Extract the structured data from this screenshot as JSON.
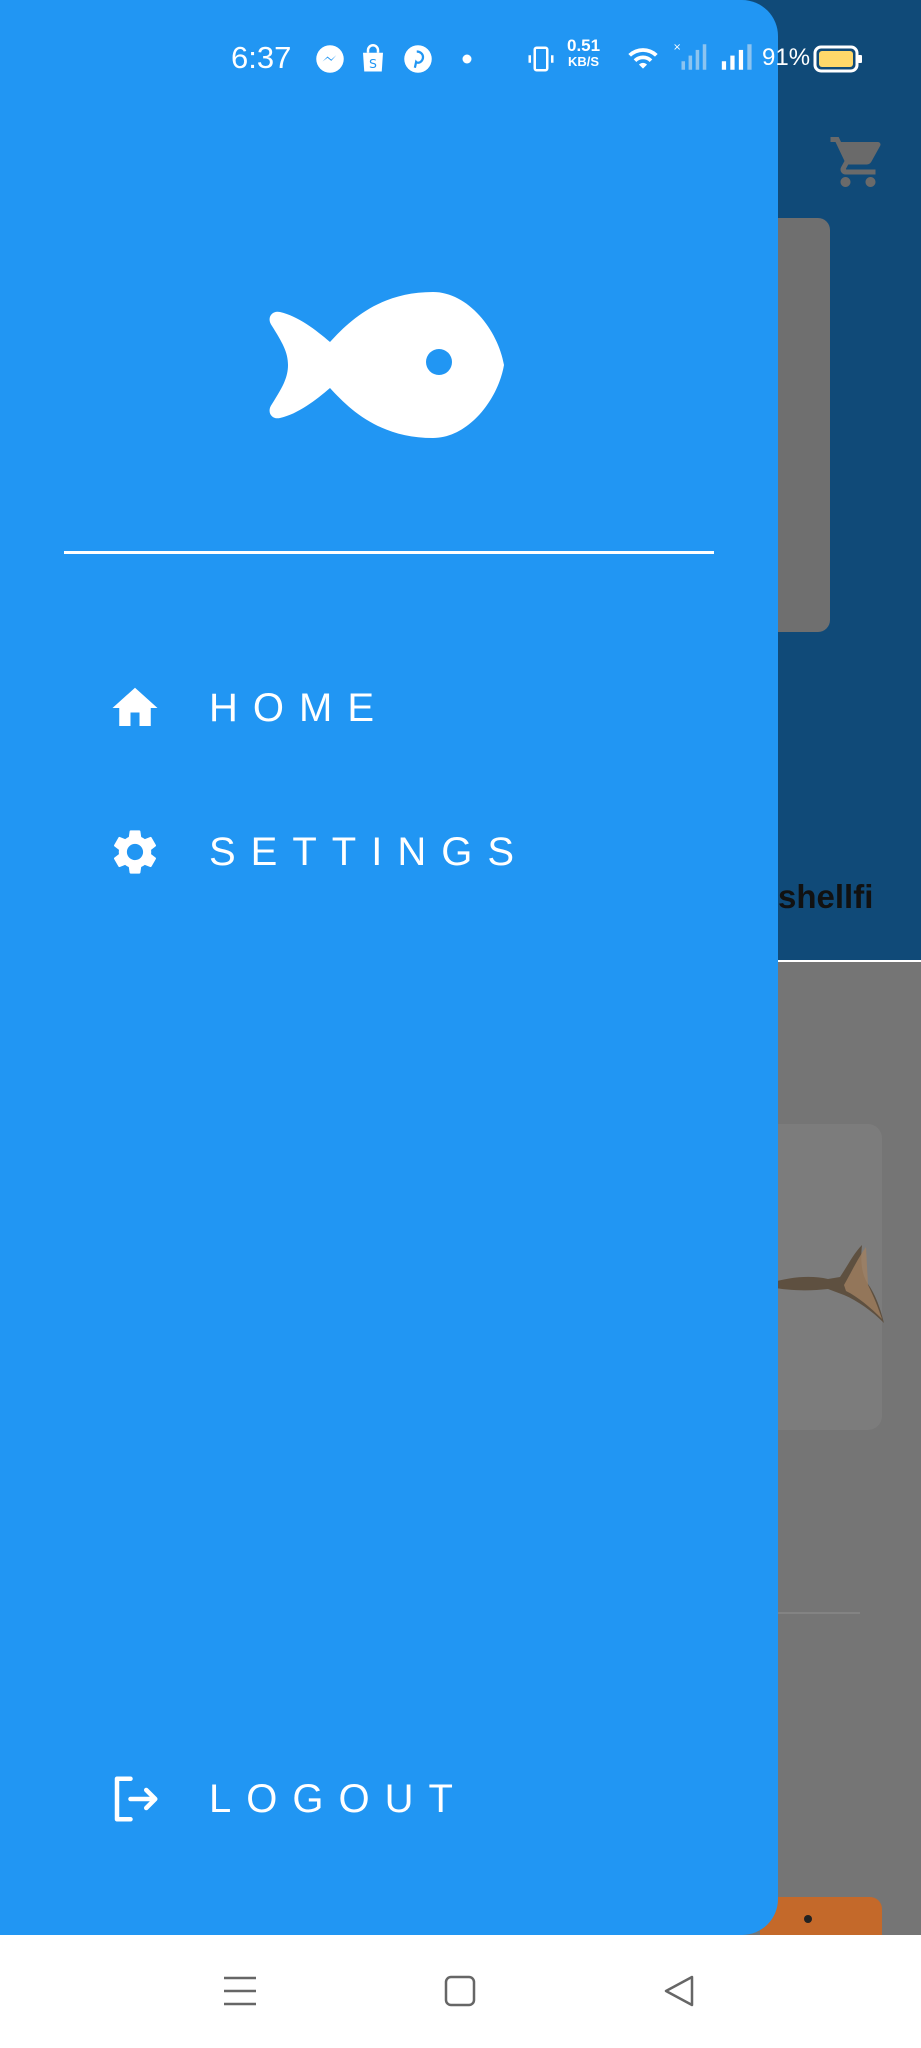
{
  "status_bar": {
    "time": "6:37",
    "net_speed_value": "0.51",
    "net_speed_unit": "KB/S",
    "battery": "91%",
    "icons": [
      "messenger-icon",
      "shopping-bag-icon",
      "pinterest-icon",
      "dot-icon",
      "vibrate-icon",
      "wifi-icon",
      "signal-icon",
      "signal-icon",
      "battery-icon"
    ]
  },
  "background": {
    "shell_text": "shellfi",
    "header_color": "#104a78",
    "icons": [
      "cart-icon"
    ]
  },
  "drawer": {
    "color": "#2196f3",
    "logo_icon": "fish-icon",
    "menu": [
      {
        "label": "HOME",
        "icon": "home-icon"
      },
      {
        "label": "SETTINGS",
        "icon": "gear-icon"
      }
    ],
    "logout": {
      "label": "LOGOUT",
      "icon": "logout-icon"
    }
  },
  "nav_bar": {
    "buttons": [
      "menu-icon",
      "home-square-icon",
      "back-triangle-icon"
    ]
  }
}
